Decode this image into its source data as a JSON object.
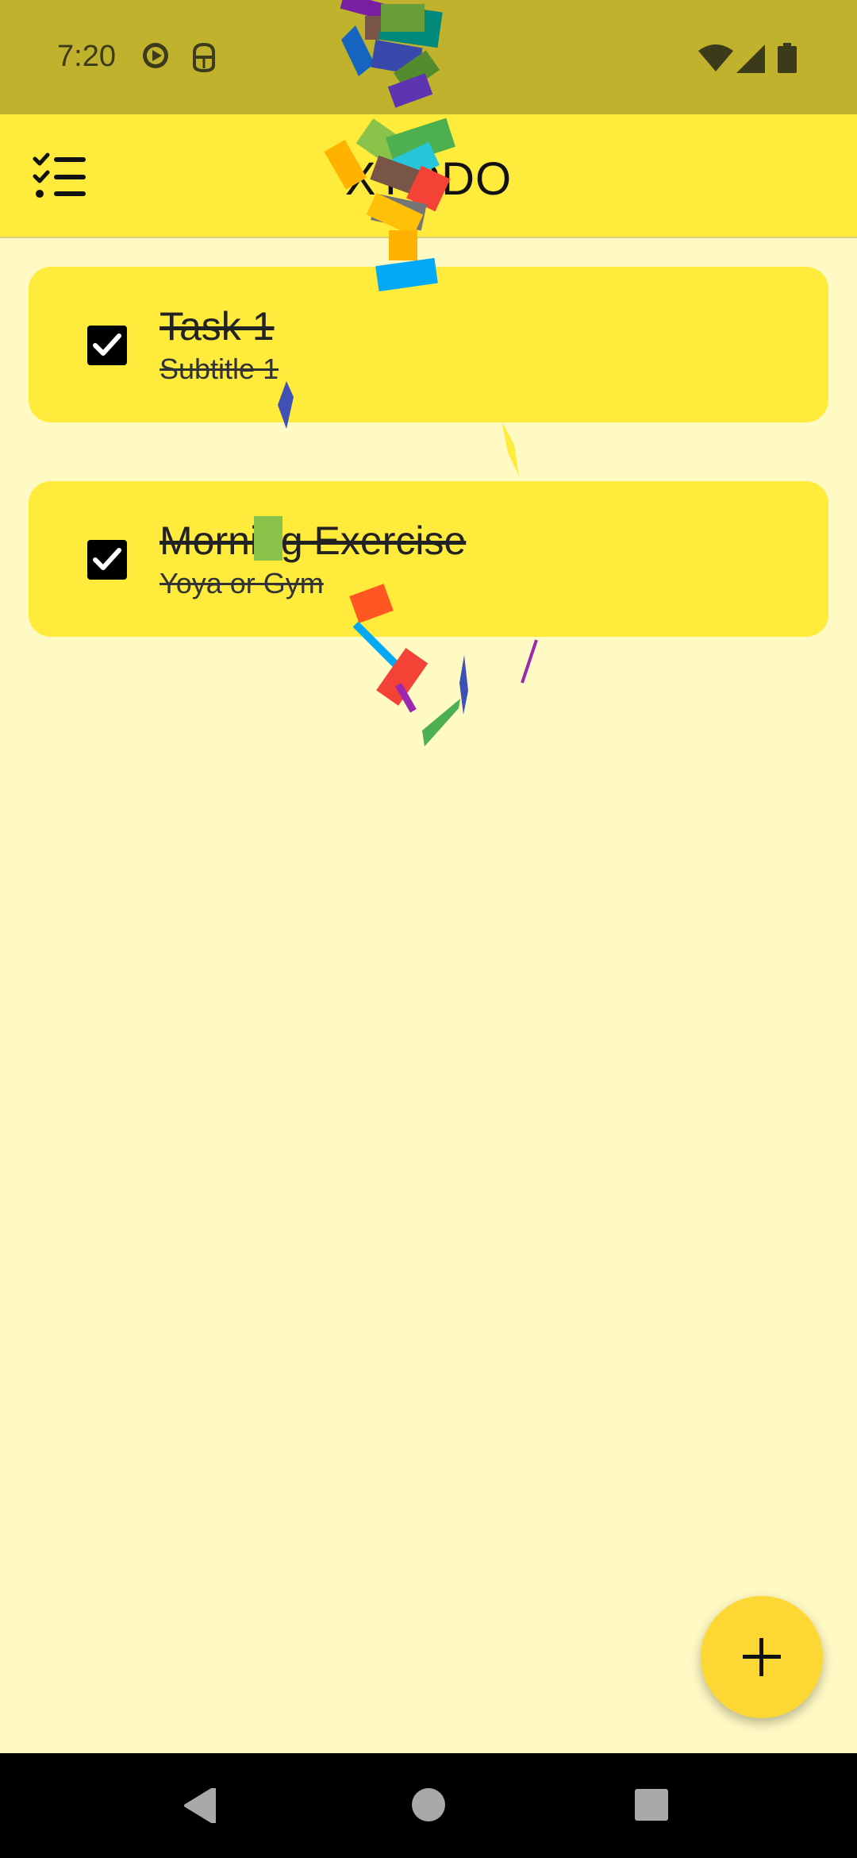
{
  "status_bar": {
    "time": "7:20",
    "left_icons": [
      "play-circle-icon",
      "android-debug-icon"
    ],
    "right_icons": [
      "wifi-icon",
      "cell-signal-icon",
      "battery-icon"
    ]
  },
  "app_bar": {
    "title": "XTODO",
    "menu_icon": "checklist-icon"
  },
  "tasks": [
    {
      "title": "Task 1",
      "subtitle": "Subtitle 1",
      "completed": true
    },
    {
      "title": "Morning Exercise",
      "subtitle": "Yoya or Gym",
      "completed": true
    }
  ],
  "fab": {
    "icon": "plus-icon",
    "symbol": "+"
  },
  "nav_bar": {
    "icons": [
      "back-icon",
      "home-icon",
      "recents-icon"
    ]
  },
  "colors": {
    "status_bar": "#C0B22C",
    "app_bar": "#FFEB3B",
    "background": "#FFF9C4",
    "card": "#FFEB3B",
    "fab": "#FDD835"
  }
}
